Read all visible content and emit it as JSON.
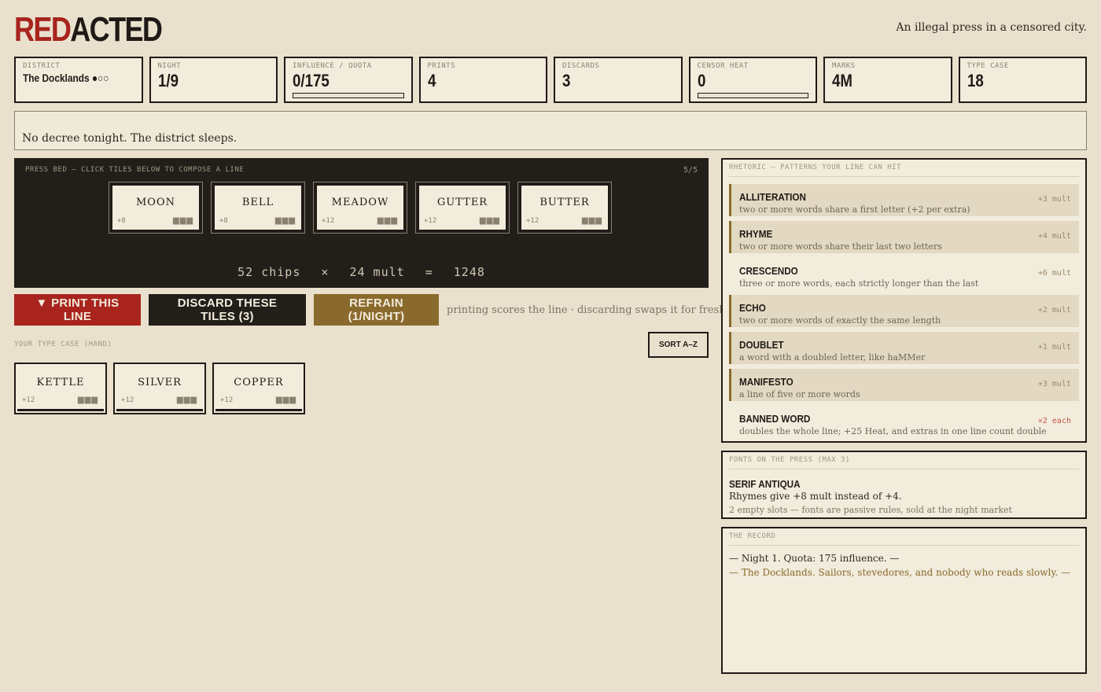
{
  "header": {
    "logo_red": "RED",
    "logo_black": "ACTED",
    "tagline": "An illegal press in a censored city."
  },
  "stats": [
    {
      "label": "DISTRICT",
      "value": "The Docklands ●○○"
    },
    {
      "label": "NIGHT",
      "value": "1/9"
    },
    {
      "label": "INFLUENCE / QUOTA",
      "value": "0/175",
      "progress": 0
    },
    {
      "label": "PRINTS",
      "value": "4"
    },
    {
      "label": "DISCARDS",
      "value": "3"
    },
    {
      "label": "CENSOR HEAT",
      "value": "0",
      "progress": 0
    },
    {
      "label": "MARKS",
      "value": "4M"
    },
    {
      "label": "TYPE CASE",
      "value": "18"
    }
  ],
  "decree": "No decree tonight. The district sleeps.",
  "press_bed": {
    "label": "PRESS BED — CLICK TILES BELOW TO COMPOSE A LINE",
    "count": "5/5",
    "tiles": [
      {
        "word": "MOON",
        "points": "+8"
      },
      {
        "word": "BELL",
        "points": "+8"
      },
      {
        "word": "MEADOW",
        "points": "+12"
      },
      {
        "word": "GUTTER",
        "points": "+12"
      },
      {
        "word": "BUTTER",
        "points": "+12"
      }
    ],
    "chips": "52 chips",
    "times": "×",
    "mult": "24 mult",
    "equals": "=",
    "total": "1248"
  },
  "actions": {
    "print": "▼ PRINT THIS LINE",
    "discard": "DISCARD THESE TILES (3)",
    "refrain": "REFRAIN (1/NIGHT)",
    "hint": "printing scores the line · discarding swaps it for fresh type"
  },
  "hand": {
    "label": "YOUR TYPE CASE (HAND)",
    "sort": "SORT A–Z",
    "tiles": [
      {
        "word": "KETTLE",
        "points": "+12"
      },
      {
        "word": "SILVER",
        "points": "+12"
      },
      {
        "word": "COPPER",
        "points": "+12"
      }
    ]
  },
  "rhetoric": {
    "title": "RHETORIC — PATTERNS YOUR LINE CAN HIT",
    "rows": [
      {
        "name": "ALLITERATION",
        "desc": "two or more words share a first letter (+2 per extra)",
        "bonus": "+3 mult",
        "active": true
      },
      {
        "name": "RHYME",
        "desc": "two or more words share their last two letters",
        "bonus": "+4 mult",
        "active": true
      },
      {
        "name": "CRESCENDO",
        "desc": "three or more words, each strictly longer than the last",
        "bonus": "+6 mult",
        "active": false
      },
      {
        "name": "ECHO",
        "desc": "two or more words of exactly the same length",
        "bonus": "+2 mult",
        "active": true
      },
      {
        "name": "DOUBLET",
        "desc": "a word with a doubled letter, like haMMer",
        "bonus": "+1 mult",
        "active": true
      },
      {
        "name": "MANIFESTO",
        "desc": "a line of five or more words",
        "bonus": "+3 mult",
        "active": true
      },
      {
        "name": "BANNED WORD",
        "desc": "doubles the whole line; +25 Heat, and extras in one line count double",
        "bonus": "×2 each",
        "active": false
      }
    ]
  },
  "fonts": {
    "title": "FONTS ON THE PRESS (MAX 3)",
    "name": "SERIF ANTIQUA",
    "desc": "Rhymes give +8 mult instead of +4.",
    "slots": "2 empty slots — fonts are passive rules, sold at the night market"
  },
  "record": {
    "title": "THE RECORD",
    "lines": [
      "— Night 1. Quota: 175 influence. —",
      "— The Docklands. Sailors, stevedores, and nobody who reads slowly. —"
    ]
  },
  "colors": {
    "accent_red": "#a8241d",
    "accent_gold": "#8a6a2c",
    "ink": "#1f1a16",
    "paper": "#f2ecdd",
    "background": "#e9e1cd"
  }
}
